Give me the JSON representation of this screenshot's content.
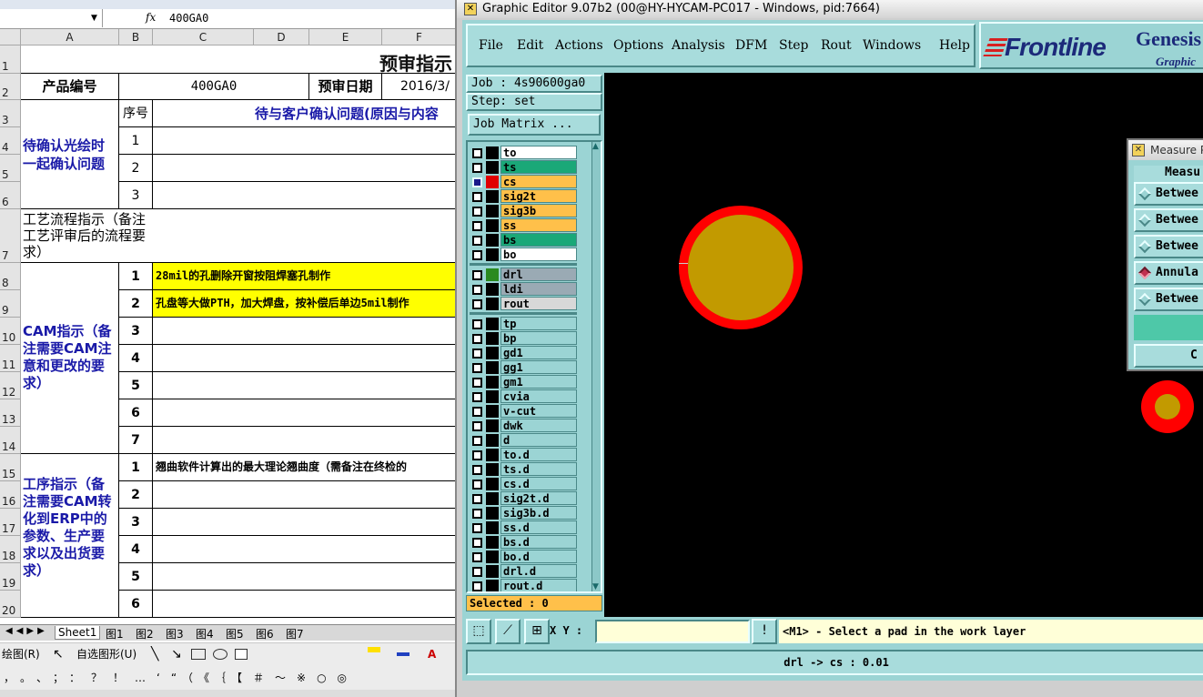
{
  "excel": {
    "formula_bar": {
      "fx": "fx",
      "value": "400GA0"
    },
    "columns": [
      "A",
      "B",
      "C",
      "D",
      "E",
      "F"
    ],
    "rows": [
      "1",
      "2",
      "3",
      "4",
      "5",
      "6",
      "7",
      "8",
      "9",
      "10",
      "11",
      "12",
      "13",
      "14",
      "15",
      "16",
      "17",
      "18",
      "19",
      "20"
    ],
    "title": "预审指示",
    "product_label": "产品编号",
    "product_value": "400GA0",
    "review_date_label": "预审日期",
    "review_date_value": "2016/3/",
    "seq_header": "序号",
    "confirm_header": "待与客户确认问题(原因与内容",
    "section_confirm": "待确认光绘时一起确认问题",
    "section_process": "工艺流程指示（备注工艺评审后的流程要求）",
    "section_cam": "CAM指示（备注需要CAM注意和更改的要求）",
    "section_work": "工序指示（备注需要CAM转化到ERP中的参数、生产要求以及出货要求）",
    "seq": {
      "c1": "1",
      "c2": "2",
      "c3": "3",
      "m1": "1",
      "m2": "2",
      "m3": "3",
      "m4": "4",
      "m5": "5",
      "m6": "6",
      "m7": "7",
      "w1": "1",
      "w2": "2",
      "w3": "3",
      "w4": "4",
      "w5": "5",
      "w6": "6"
    },
    "cam_line1": "28mil的孔删除开窗按阻焊塞孔制作",
    "cam_line2": "孔盘等大做PTH，加大焊盘，按补偿后单边5mil制作",
    "work_line1": "翘曲软件计算出的最大理论翘曲度（需备注在终检的",
    "sheet_tabs": [
      "Sheet1",
      "图1",
      "图2",
      "图3",
      "图4",
      "图5",
      "图6",
      "图7"
    ],
    "draw_label": "绘图(R)",
    "autoshape_label": "自选图形(U)",
    "symbols": "，。、；：？！…‘“（《｛【＃～※○◎"
  },
  "genesis": {
    "title": "Graphic Editor 9.07b2 (00@HY-HYCAM-PC017 - Windows, pid:7664)",
    "menu": [
      "File",
      "Edit",
      "Actions",
      "Options",
      "Analysis",
      "DFM",
      "Step",
      "Rout",
      "Windows",
      "Help"
    ],
    "logo_text": "Frontline",
    "product_name": "Genesis",
    "product_sub": "Graphic",
    "job": "Job : 4s90600ga0",
    "step": "Step: set",
    "job_matrix": "Job Matrix ...",
    "layers_group1": [
      {
        "name": "to",
        "color": "#ffffff"
      },
      {
        "name": "ts",
        "color": "#1aa878"
      },
      {
        "name": "cs",
        "color": "#ffc04a"
      },
      {
        "name": "sig2t",
        "color": "#ffc04a"
      },
      {
        "name": "sig3b",
        "color": "#ffc04a"
      },
      {
        "name": "ss",
        "color": "#ffc04a"
      },
      {
        "name": "bs",
        "color": "#1aa878"
      },
      {
        "name": "bo",
        "color": "#ffffff"
      }
    ],
    "layers_group2": [
      {
        "name": "drl",
        "color": "#9aaab4"
      },
      {
        "name": "ldi",
        "color": "#9aaab4"
      },
      {
        "name": "rout",
        "color": "#d8d8d8"
      }
    ],
    "layers_group3": [
      "tp",
      "bp",
      "gd1",
      "gg1",
      "gm1",
      "cvia",
      "v-cut",
      "dwk",
      "d",
      "to.d",
      "ts.d",
      "cs.d",
      "sig2t.d",
      "sig3b.d",
      "ss.d",
      "bs.d",
      "bo.d",
      "drl.d",
      "rout.d"
    ],
    "work_layer": "cs",
    "selected": "Selected : 0",
    "xy_label": "X Y :",
    "prompt": "<M1> - Select a pad in the work layer",
    "message": "drl -> cs : 0.01",
    "measure": {
      "title": "Measure P",
      "header": "Measu",
      "options": [
        "Betwee",
        "Betwee",
        "Betwee",
        "Annula",
        "Betwee"
      ],
      "selected_index": 3,
      "button": "C"
    },
    "colors": {
      "pad_ring": "#ff0000",
      "pad_fill": "#c29a00",
      "canvas": "#000000",
      "panel": "#9bd4d4"
    }
  }
}
